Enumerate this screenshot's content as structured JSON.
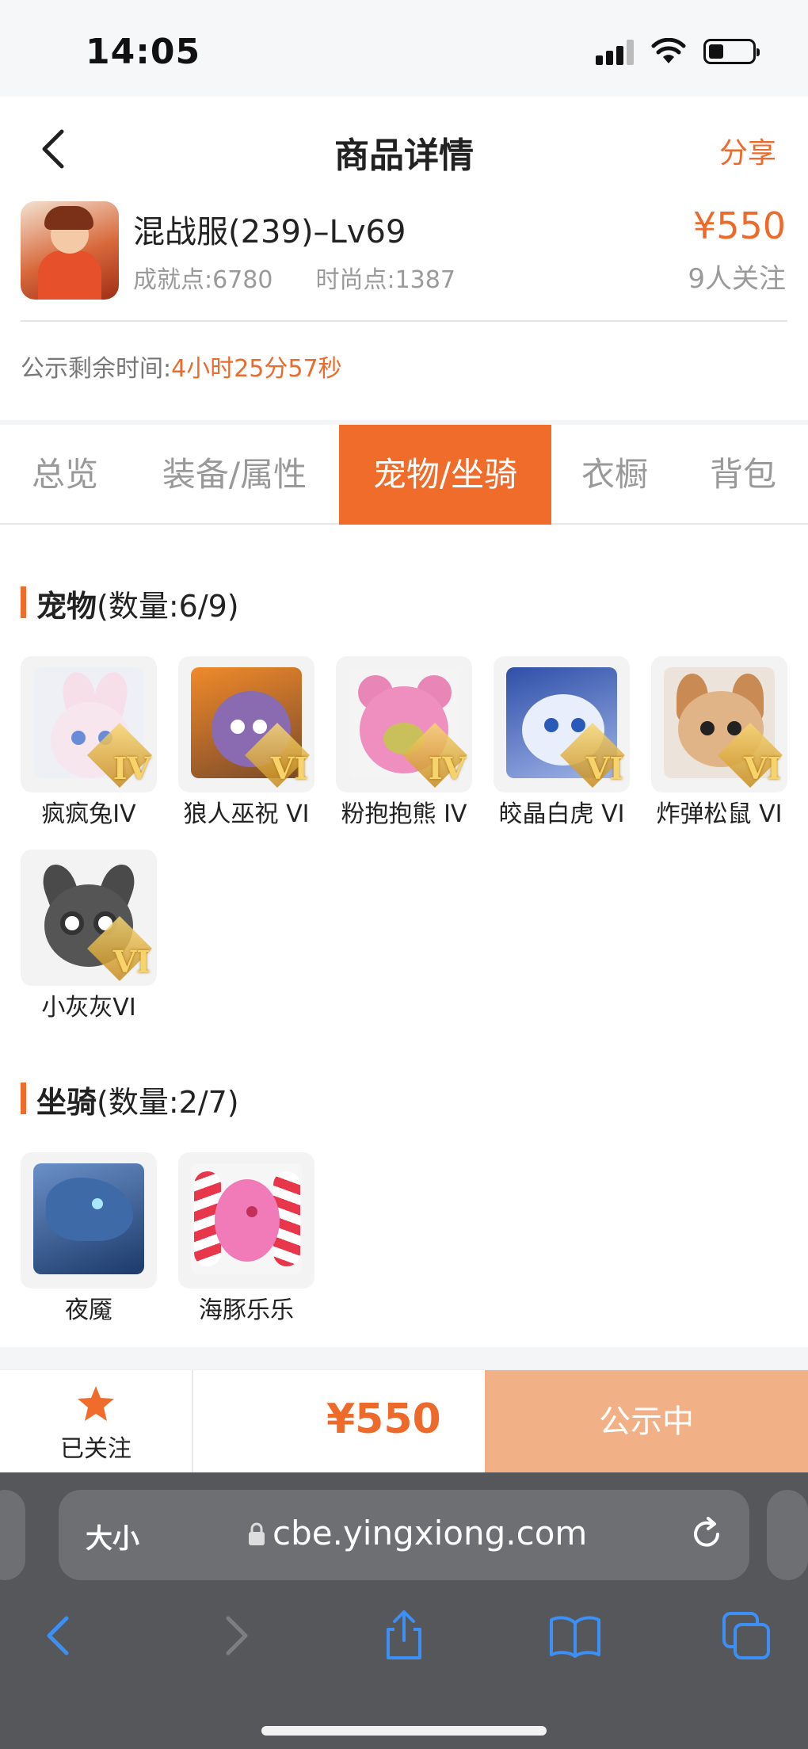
{
  "status_bar": {
    "time": "14:05"
  },
  "nav": {
    "title": "商品详情",
    "share_label": "分享"
  },
  "product": {
    "name": "混战服(239)–Lv69",
    "achievement": "成就点:6780",
    "fashion": "时尚点:1387",
    "price": "¥550",
    "followers": "9人关注",
    "countdown_label": "公示剩余时间:",
    "countdown_value": "4小时25分57秒"
  },
  "tabs": [
    {
      "label": "总览",
      "active": false
    },
    {
      "label": "装备/属性",
      "active": false
    },
    {
      "label": "宠物/坐骑",
      "active": true
    },
    {
      "label": "衣橱",
      "active": false
    },
    {
      "label": "背包",
      "active": false
    }
  ],
  "pets": {
    "title": "宠物",
    "count": "(数量:6/9)",
    "items": [
      {
        "name": "疯疯兔IV",
        "grade": "IV",
        "icon": "rabbit-pet-icon"
      },
      {
        "name": "狼人巫祝 VI",
        "grade": "VI",
        "icon": "werewolf-pet-icon"
      },
      {
        "name": "粉抱抱熊 IV",
        "grade": "IV",
        "icon": "pink-bear-pet-icon"
      },
      {
        "name": "皎晶白虎 VI",
        "grade": "VI",
        "icon": "white-tiger-pet-icon"
      },
      {
        "name": "炸弹松鼠 VI",
        "grade": "VI",
        "icon": "squirrel-pet-icon"
      },
      {
        "name": "小灰灰VI",
        "grade": "VI",
        "icon": "grey-wolf-pet-icon"
      }
    ]
  },
  "mounts": {
    "title": "坐骑",
    "count": "(数量:2/7)",
    "items": [
      {
        "name": "夜魇",
        "icon": "dragon-mount-icon"
      },
      {
        "name": "海豚乐乐",
        "icon": "dolphin-mount-icon"
      }
    ]
  },
  "action_bar": {
    "follow_label": "已关注",
    "price": "¥550",
    "status_button": "公示中"
  },
  "browser": {
    "text_size": "大小",
    "host": "cbe.yingxiong.com"
  },
  "colors": {
    "accent": "#ef6c2b",
    "button_disabled": "#f2b087"
  }
}
